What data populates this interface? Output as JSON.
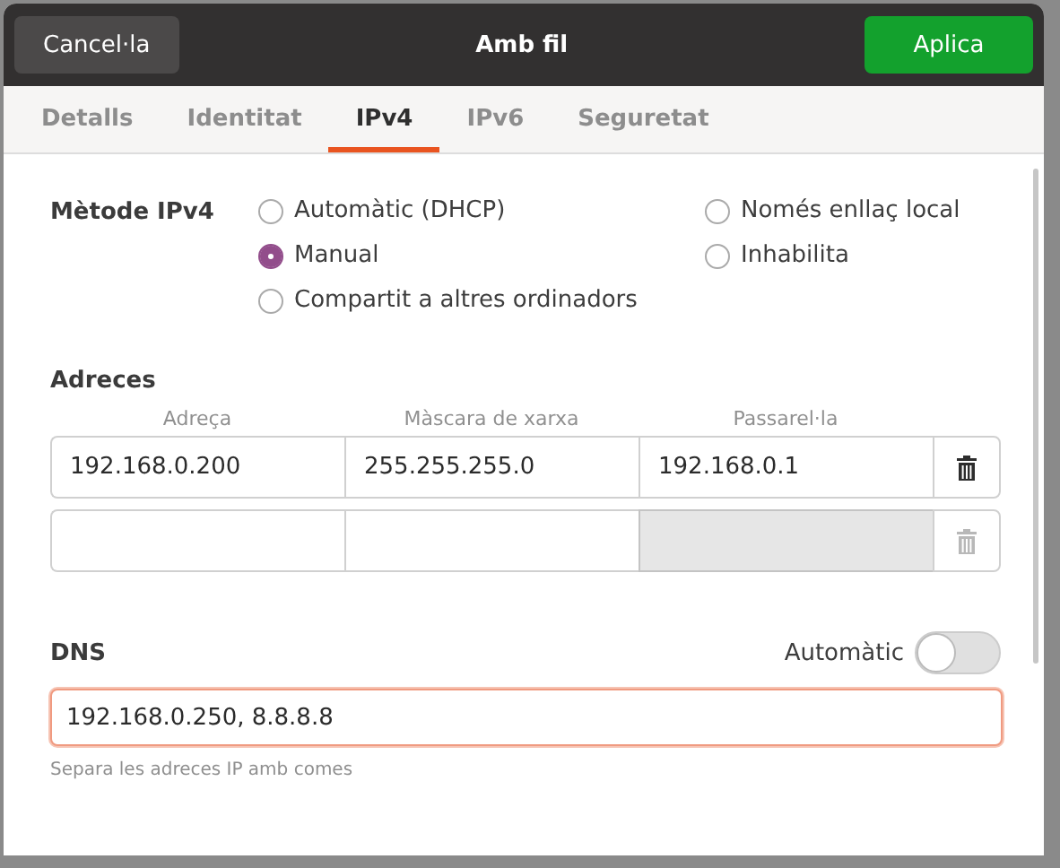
{
  "header": {
    "cancel": "Cancel·la",
    "title": "Amb fil",
    "apply": "Aplica"
  },
  "tabs": [
    {
      "label": "Detalls",
      "selected": false
    },
    {
      "label": "Identitat",
      "selected": false
    },
    {
      "label": "IPv4",
      "selected": true
    },
    {
      "label": "IPv6",
      "selected": false
    },
    {
      "label": "Seguretat",
      "selected": false
    }
  ],
  "method": {
    "label": "Mètode IPv4",
    "options": [
      {
        "label": "Automàtic (DHCP)",
        "selected": false
      },
      {
        "label": "Només enllaç local",
        "selected": false
      },
      {
        "label": "Manual",
        "selected": true
      },
      {
        "label": "Inhabilita",
        "selected": false
      },
      {
        "label": "Compartit a altres ordinadors",
        "selected": false
      }
    ]
  },
  "addresses": {
    "title": "Adreces",
    "columns": [
      "Adreça",
      "Màscara de xarxa",
      "Passarel·la"
    ],
    "rows": [
      {
        "cells": [
          {
            "value": "192.168.0.200",
            "disabled": false
          },
          {
            "value": "255.255.255.0",
            "disabled": false
          },
          {
            "value": "192.168.0.1",
            "disabled": false
          }
        ],
        "delete_disabled": false
      },
      {
        "cells": [
          {
            "disabled": false
          },
          {
            "disabled": false
          },
          {
            "disabled": true
          }
        ],
        "delete_disabled": true
      }
    ]
  },
  "dns": {
    "title": "DNS",
    "auto_label": "Automàtic",
    "auto_on": false,
    "value": "192.168.0.250, 8.8.8.8",
    "focused": true,
    "hint": "Separa les adreces IP amb comes"
  }
}
